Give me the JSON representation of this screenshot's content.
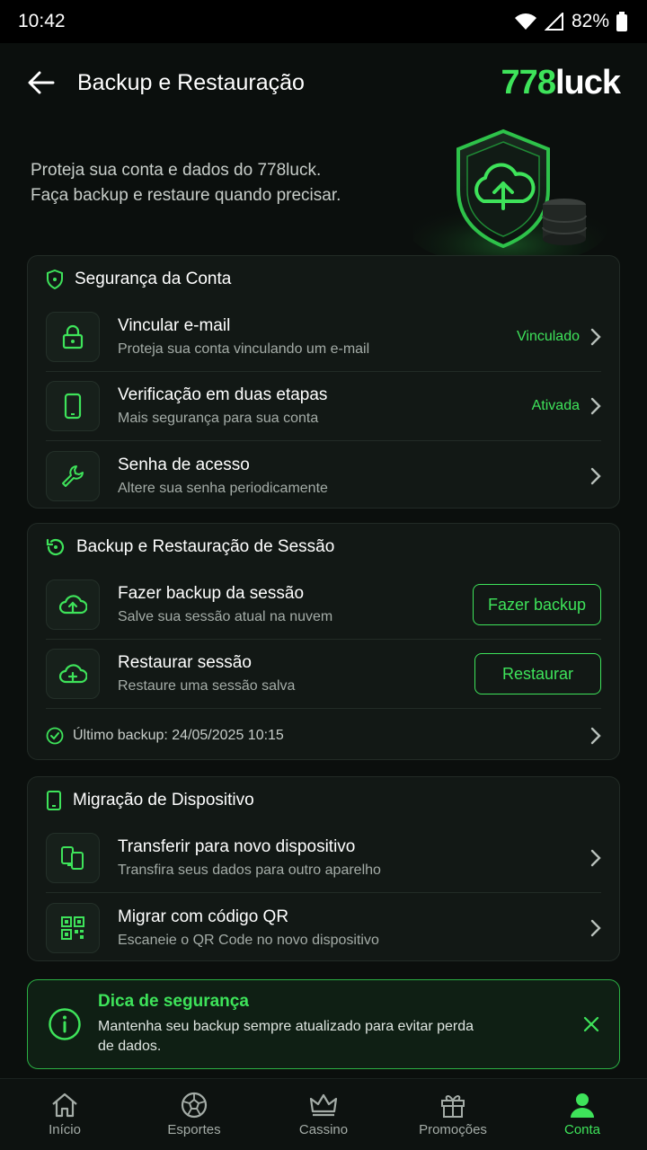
{
  "status_bar": {
    "time": "10:42",
    "battery": "82%"
  },
  "header": {
    "title": "Backup e Restauração",
    "brand_num": "778",
    "brand_text": "luck"
  },
  "hero": {
    "line1": "Proteja sua conta e dados do 778luck.",
    "line2": "Faça backup e restaure quando precisar."
  },
  "security": {
    "title": "Segurança da Conta",
    "items": [
      {
        "title": "Vincular e-mail",
        "subtitle": "Proteja sua conta vinculando um e-mail",
        "status": "Vinculado",
        "icon": "lock-icon"
      },
      {
        "title": "Verificação em duas etapas",
        "subtitle": "Mais segurança para sua conta",
        "status": "Ativada",
        "icon": "phone-icon"
      },
      {
        "title": "Senha de acesso",
        "subtitle": "Altere sua senha periodicamente",
        "status": "",
        "icon": "wrench-icon"
      }
    ]
  },
  "backup": {
    "title": "Backup e Restauração de Sessão",
    "items": [
      {
        "title": "Fazer backup da sessão",
        "subtitle": "Salve sua sessão atual na nuvem",
        "button": "Fazer backup",
        "icon": "cloud-upload-icon"
      },
      {
        "title": "Restaurar sessão",
        "subtitle": "Restaure uma sessão salva",
        "button": "Restaurar",
        "icon": "cloud-restore-icon"
      }
    ],
    "last_backup": "Último backup: 24/05/2025 10:15"
  },
  "migration": {
    "title": "Migração de Dispositivo",
    "items": [
      {
        "title": "Transferir para novo dispositivo",
        "subtitle": "Transfira seus dados para outro aparelho",
        "icon": "devices-icon"
      },
      {
        "title": "Migrar com código QR",
        "subtitle": "Escaneie o QR Code no novo dispositivo",
        "icon": "qr-icon"
      }
    ]
  },
  "tip": {
    "title": "Dica de segurança",
    "text": "Mantenha seu backup sempre atualizado para evitar perda de dados."
  },
  "nav": [
    {
      "label": "Início",
      "icon": "home-icon"
    },
    {
      "label": "Esportes",
      "icon": "ball-icon"
    },
    {
      "label": "Cassino",
      "icon": "crown-icon"
    },
    {
      "label": "Promoções",
      "icon": "gift-icon"
    },
    {
      "label": "Conta",
      "icon": "user-icon",
      "active": true
    }
  ],
  "colors": {
    "accent": "#3ee35a",
    "background": "#0b0f0d",
    "card": "#121815"
  }
}
